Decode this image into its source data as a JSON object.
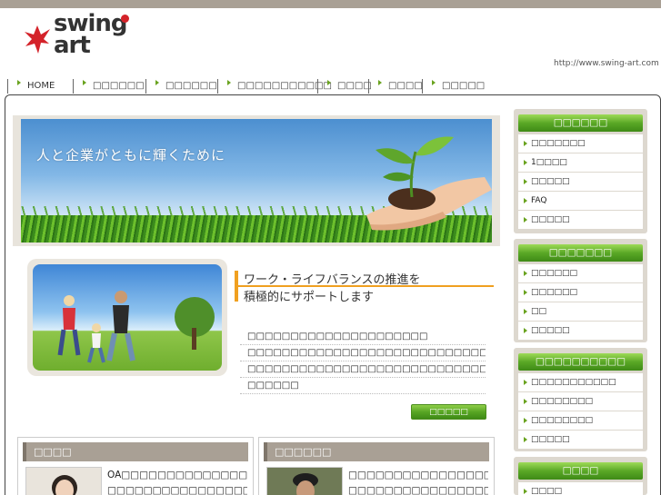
{
  "header": {
    "logo_line1": "swing",
    "logo_line2": "art",
    "url": "http://www.swing-art.com"
  },
  "nav": {
    "items": [
      {
        "label": "HOME"
      },
      {
        "label": "□□□□□□"
      },
      {
        "label": "□□□□□□"
      },
      {
        "label": "□□□□□□□□□□□"
      },
      {
        "label": "□□□□"
      },
      {
        "label": "□□□□"
      },
      {
        "label": "□□□□□"
      }
    ]
  },
  "hero": {
    "text": "人と企業がともに輝くために"
  },
  "intro": {
    "headline1": "ワーク・ライフバランスの推進を",
    "headline2": "積極的にサポートします",
    "lines": [
      "□□□□□□□□□□□□□□□□□□□□□",
      "□□□□□□□□□□□□□□□□□□□□□□□□□□□□□□□□□□□",
      "□□□□□□□□□□□□□□□□□□□□□□□□□□□□□□□□□□□",
      "□□□□□□"
    ],
    "button": "□□□□□"
  },
  "boxes": [
    {
      "title": "□□□□",
      "lines": [
        "OA□□□□□□□□□□□□□□□□□□□",
        "□□□□□□□□□□□□□□□□□□□□□"
      ]
    },
    {
      "title": "□□□□□□",
      "lines": [
        "□□□□□□□□□□□□□□□□□□□□□",
        "□□□□□□□□□□□□□□□□□□□"
      ]
    }
  ],
  "sidebar": {
    "panels": [
      {
        "title": "□□□□□□",
        "items": [
          "□□□□□□□",
          "1□□□□",
          "□□□□□",
          "FAQ",
          "□□□□□"
        ]
      },
      {
        "title": "□□□□□□□",
        "items": [
          "□□□□□□",
          "□□□□□□",
          "□□",
          "□□□□□"
        ]
      },
      {
        "title": "□□□□□□□□□□",
        "items": [
          "□□□□□□□□□□□",
          "□□□□□□□□",
          "□□□□□□□□",
          "□□□□□"
        ]
      },
      {
        "title": "□□□□",
        "items": [
          "□□□□"
        ]
      }
    ]
  }
}
